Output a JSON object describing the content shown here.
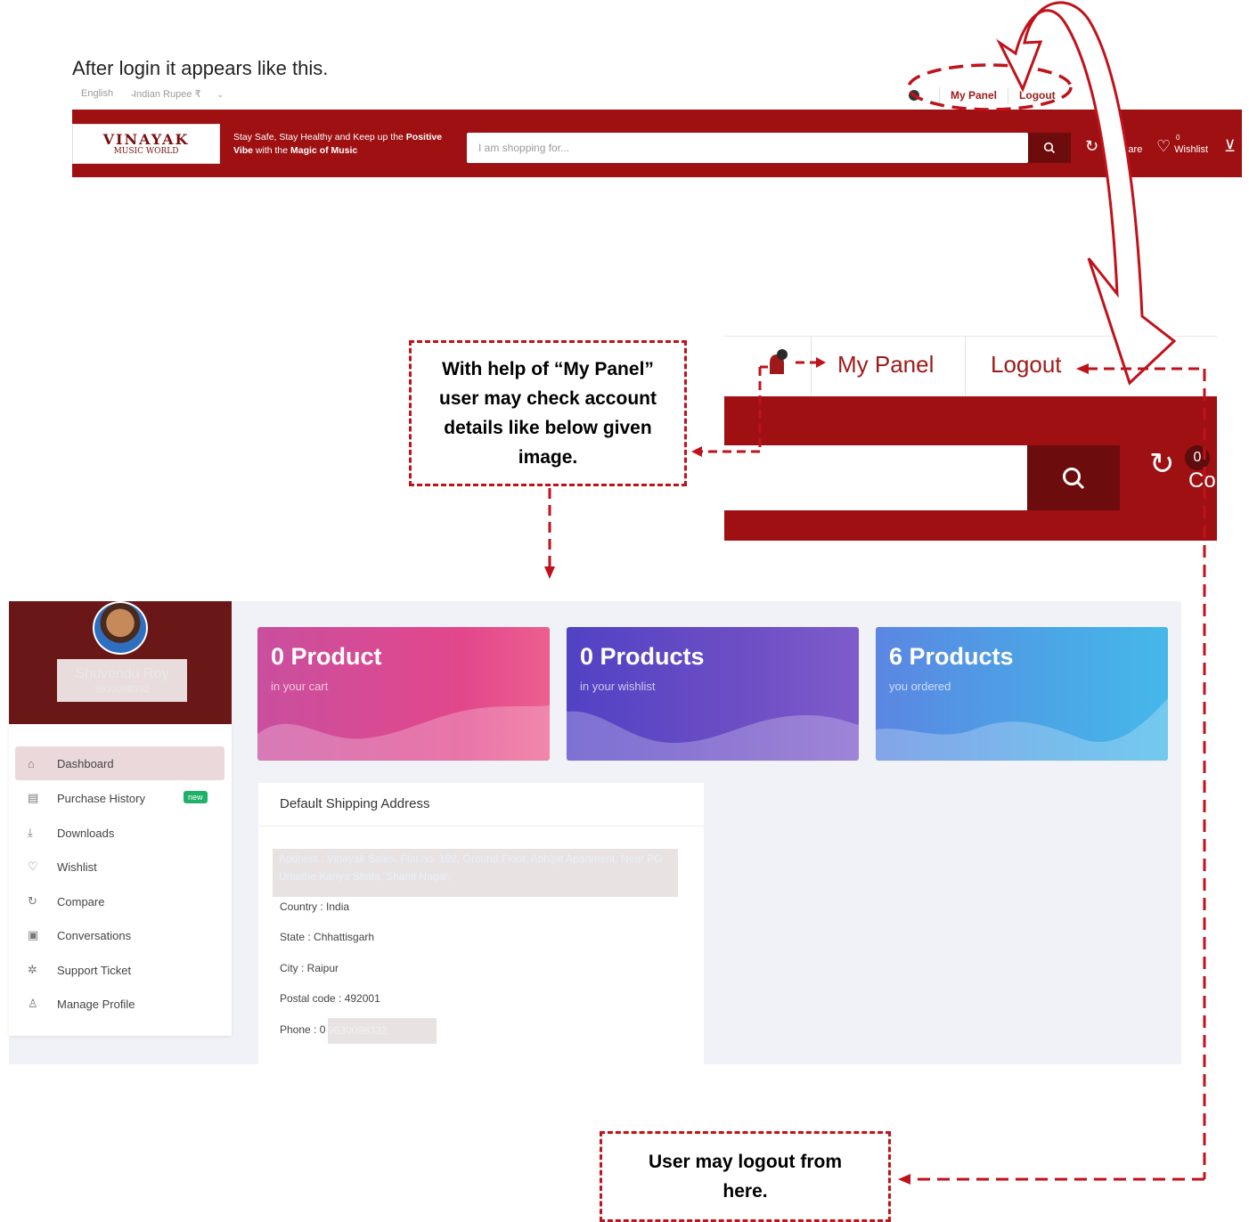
{
  "intro": "After login it appears like this.",
  "topbar": {
    "language": "English",
    "currency": "Indian Rupee ₹",
    "my_panel": "My Panel",
    "logout": "Logout"
  },
  "header": {
    "logo_title": "VINAYAK",
    "logo_subtitle": "MUSIC WORLD",
    "tagline_1": "Stay Safe, Stay Healthy and Keep up the ",
    "tagline_bold_1": "Positive",
    "tagline_bold_2": "Vibe",
    "tagline_2": " with the ",
    "tagline_bold_3": "Magic of Music",
    "search_placeholder": "I am shopping for...",
    "compare_count": "0",
    "compare_label": "Compare",
    "wishlist_count": "0",
    "wishlist_label": "Wishlist"
  },
  "zoom": {
    "my_panel": "My Panel",
    "logout": "Logout",
    "compare_count": "0",
    "compare_label_partial": "Co"
  },
  "notes": {
    "my_panel_note": "With help of “My Panel” user may check account details like below given image.",
    "logout_note": "User may logout from here."
  },
  "profile": {
    "name": "Shuvendu Roy",
    "phone": "9630098332"
  },
  "menu": [
    {
      "label": "Dashboard",
      "icon": "home-icon",
      "glyph": "⌂",
      "active": true
    },
    {
      "label": "Purchase History",
      "icon": "file-icon",
      "glyph": "▤",
      "badge": "new"
    },
    {
      "label": "Downloads",
      "icon": "download-icon",
      "glyph": "⤓"
    },
    {
      "label": "Wishlist",
      "icon": "heart-icon",
      "glyph": "♡"
    },
    {
      "label": "Compare",
      "icon": "refresh-icon",
      "glyph": "↻"
    },
    {
      "label": "Conversations",
      "icon": "chat-icon",
      "glyph": "▣"
    },
    {
      "label": "Support Ticket",
      "icon": "support-icon",
      "glyph": "✲"
    },
    {
      "label": "Manage Profile",
      "icon": "user-icon",
      "glyph": "♙"
    }
  ],
  "stats": [
    {
      "value": "0 Product",
      "caption": "in your cart"
    },
    {
      "value": "0 Products",
      "caption": "in your wishlist"
    },
    {
      "value": "6 Products",
      "caption": "you ordered"
    }
  ],
  "shipping": {
    "title": "Default Shipping Address",
    "address": "Address : Vinayak Sales, Flat no. 102, Ground Floor, Abhijat Apartment, Near PG Umathe Kanya Shala, Shanti Nagar,",
    "country": "Country : India",
    "state": "State : Chhattisgarh",
    "city": "City : Raipur",
    "postal": "Postal code : 492001",
    "phone_prefix": "Phone : 0",
    "phone_masked": "9630098332"
  }
}
